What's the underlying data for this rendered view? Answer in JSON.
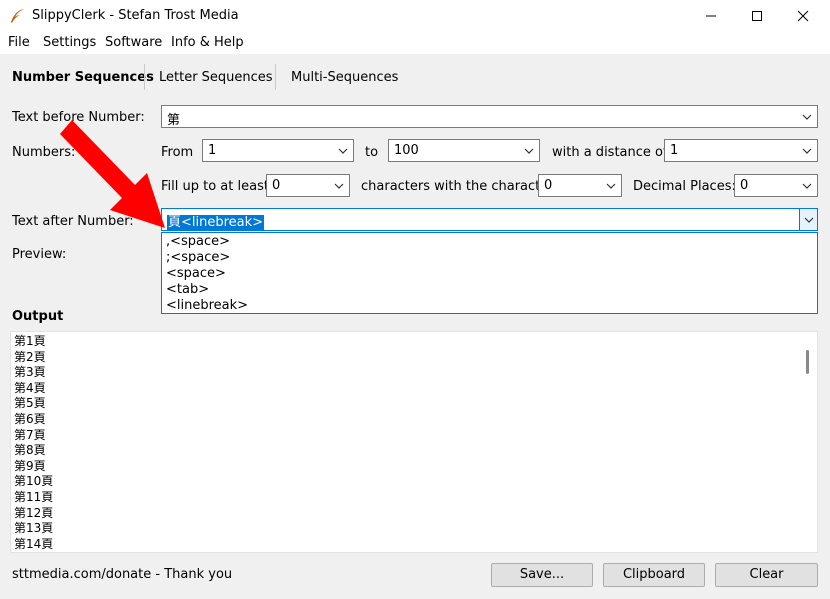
{
  "window": {
    "title": "SlippyClerk - Stefan Trost Media"
  },
  "menu": [
    "File",
    "Settings",
    "Software",
    "Info & Help"
  ],
  "tabs": [
    "Number Sequences",
    "Letter Sequences",
    "Multi-Sequences"
  ],
  "form": {
    "text_before_label": "Text before Number:",
    "text_before_value": "第",
    "numbers_label": "Numbers:",
    "from_label": "From",
    "from_value": "1",
    "to_label": "to",
    "to_value": "100",
    "distance_label": "with a distance of",
    "distance_value": "1",
    "fill_label": "Fill up to at least",
    "fill_value": "0",
    "chars_label": "characters with the character",
    "chars_value": "0",
    "decimal_label": "Decimal Places:",
    "decimal_value": "0",
    "text_after_label": "Text after Number:",
    "text_after_value": "頁<linebreak>",
    "preview_label": "Preview:"
  },
  "dropdown_options": [
    ",<space>",
    ";<space>",
    "<space>",
    "<tab>",
    "<linebreak>"
  ],
  "output": {
    "label": "Output",
    "lines": [
      "第1頁",
      "第2頁",
      "第3頁",
      "第4頁",
      "第5頁",
      "第6頁",
      "第7頁",
      "第8頁",
      "第9頁",
      "第10頁",
      "第11頁",
      "第12頁",
      "第13頁",
      "第14頁"
    ]
  },
  "footer": {
    "donate_text": "sttmedia.com/donate - Thank you",
    "save_label": "Save...",
    "clipboard_label": "Clipboard",
    "clear_label": "Clear"
  },
  "colors": {
    "accent": "#0078d7",
    "arrow": "#ff0000"
  }
}
